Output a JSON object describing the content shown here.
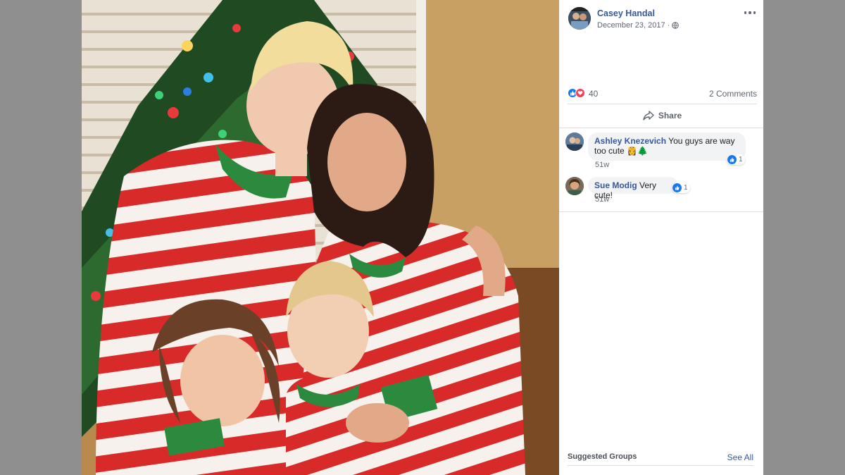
{
  "photo": {
    "description_icon": "family-photo"
  },
  "post": {
    "author": "Casey Handal",
    "date": "December 23, 2017",
    "separator": "·",
    "privacy_icon": "globe-icon",
    "more_icon": "more-options-icon"
  },
  "reactions": {
    "types": [
      "like",
      "love"
    ],
    "count": "40",
    "comments_label": "2 Comments"
  },
  "actions": {
    "share_label": "Share",
    "share_icon": "share-arrow-icon"
  },
  "comments": [
    {
      "author": "Ashley Knezevich",
      "text": "You guys are way too cute 👸🌲",
      "time": "51w",
      "likes": "1"
    },
    {
      "author": "Sue Modig",
      "text": "Very cute!",
      "time": "51w",
      "likes": "1"
    }
  ],
  "suggested": {
    "title": "Suggested Groups",
    "see_all": "See All"
  },
  "colors": {
    "link": "#385898",
    "like_blue": "#1877f2",
    "love_red": "#f33e58",
    "panel_bg": "#ffffff",
    "page_bg": "#8f8f8f"
  }
}
